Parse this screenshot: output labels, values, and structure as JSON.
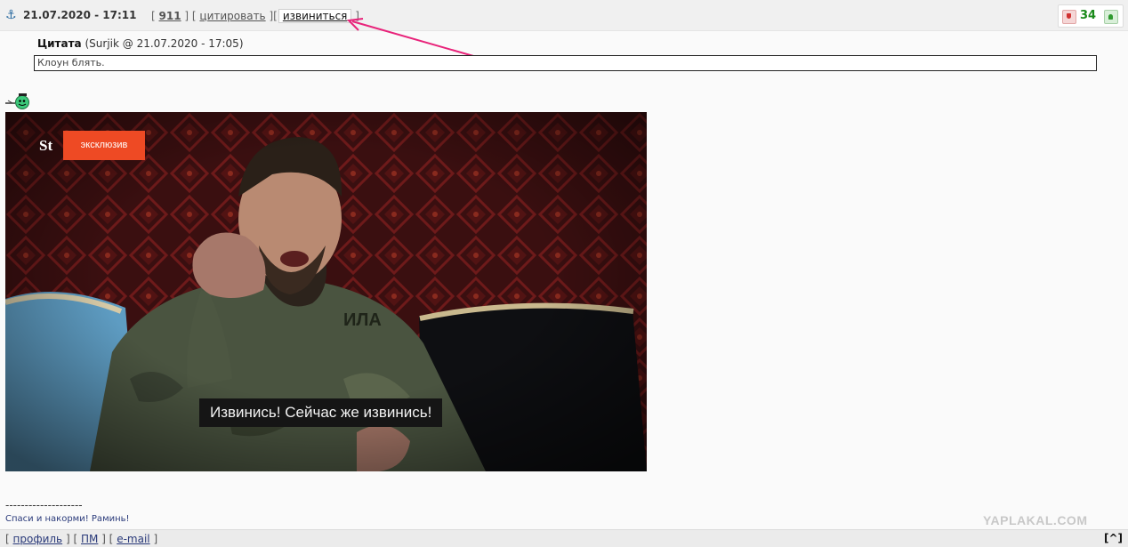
{
  "post": {
    "datetime": "21.07.2020 - 17:11",
    "number": "911",
    "quote_link": "цитировать",
    "apologize_link": "извиниться",
    "rating": "34",
    "bracket_open": "[",
    "bracket_close": "]",
    "bracket_mid": "][",
    "bracket_sep": "] ["
  },
  "quote": {
    "label": "Цитата",
    "meta": "(Surjik @ 21.07.2020 - 17:05)",
    "text": "Клоун блять."
  },
  "video": {
    "logo": "St",
    "badge": "эксклюзив",
    "subtitle": "Извинись! Сейчас же извинись!"
  },
  "signature": {
    "divider": "--------------------",
    "text": "Спаси и накорми! Раминь!"
  },
  "watermark": "YAPLAKAL.COM",
  "footer": {
    "profile": "профиль",
    "pm": "ПМ",
    "email": "e-mail",
    "top": "[^]"
  },
  "colors": {
    "arrow": "#e8237a",
    "rating": "#1a8a1a",
    "post_number": "#cc0000",
    "badge": "#ee4a24"
  },
  "icons": [
    "anchor-icon",
    "thumb-down-icon",
    "thumb-up-icon",
    "smiley-icon"
  ]
}
